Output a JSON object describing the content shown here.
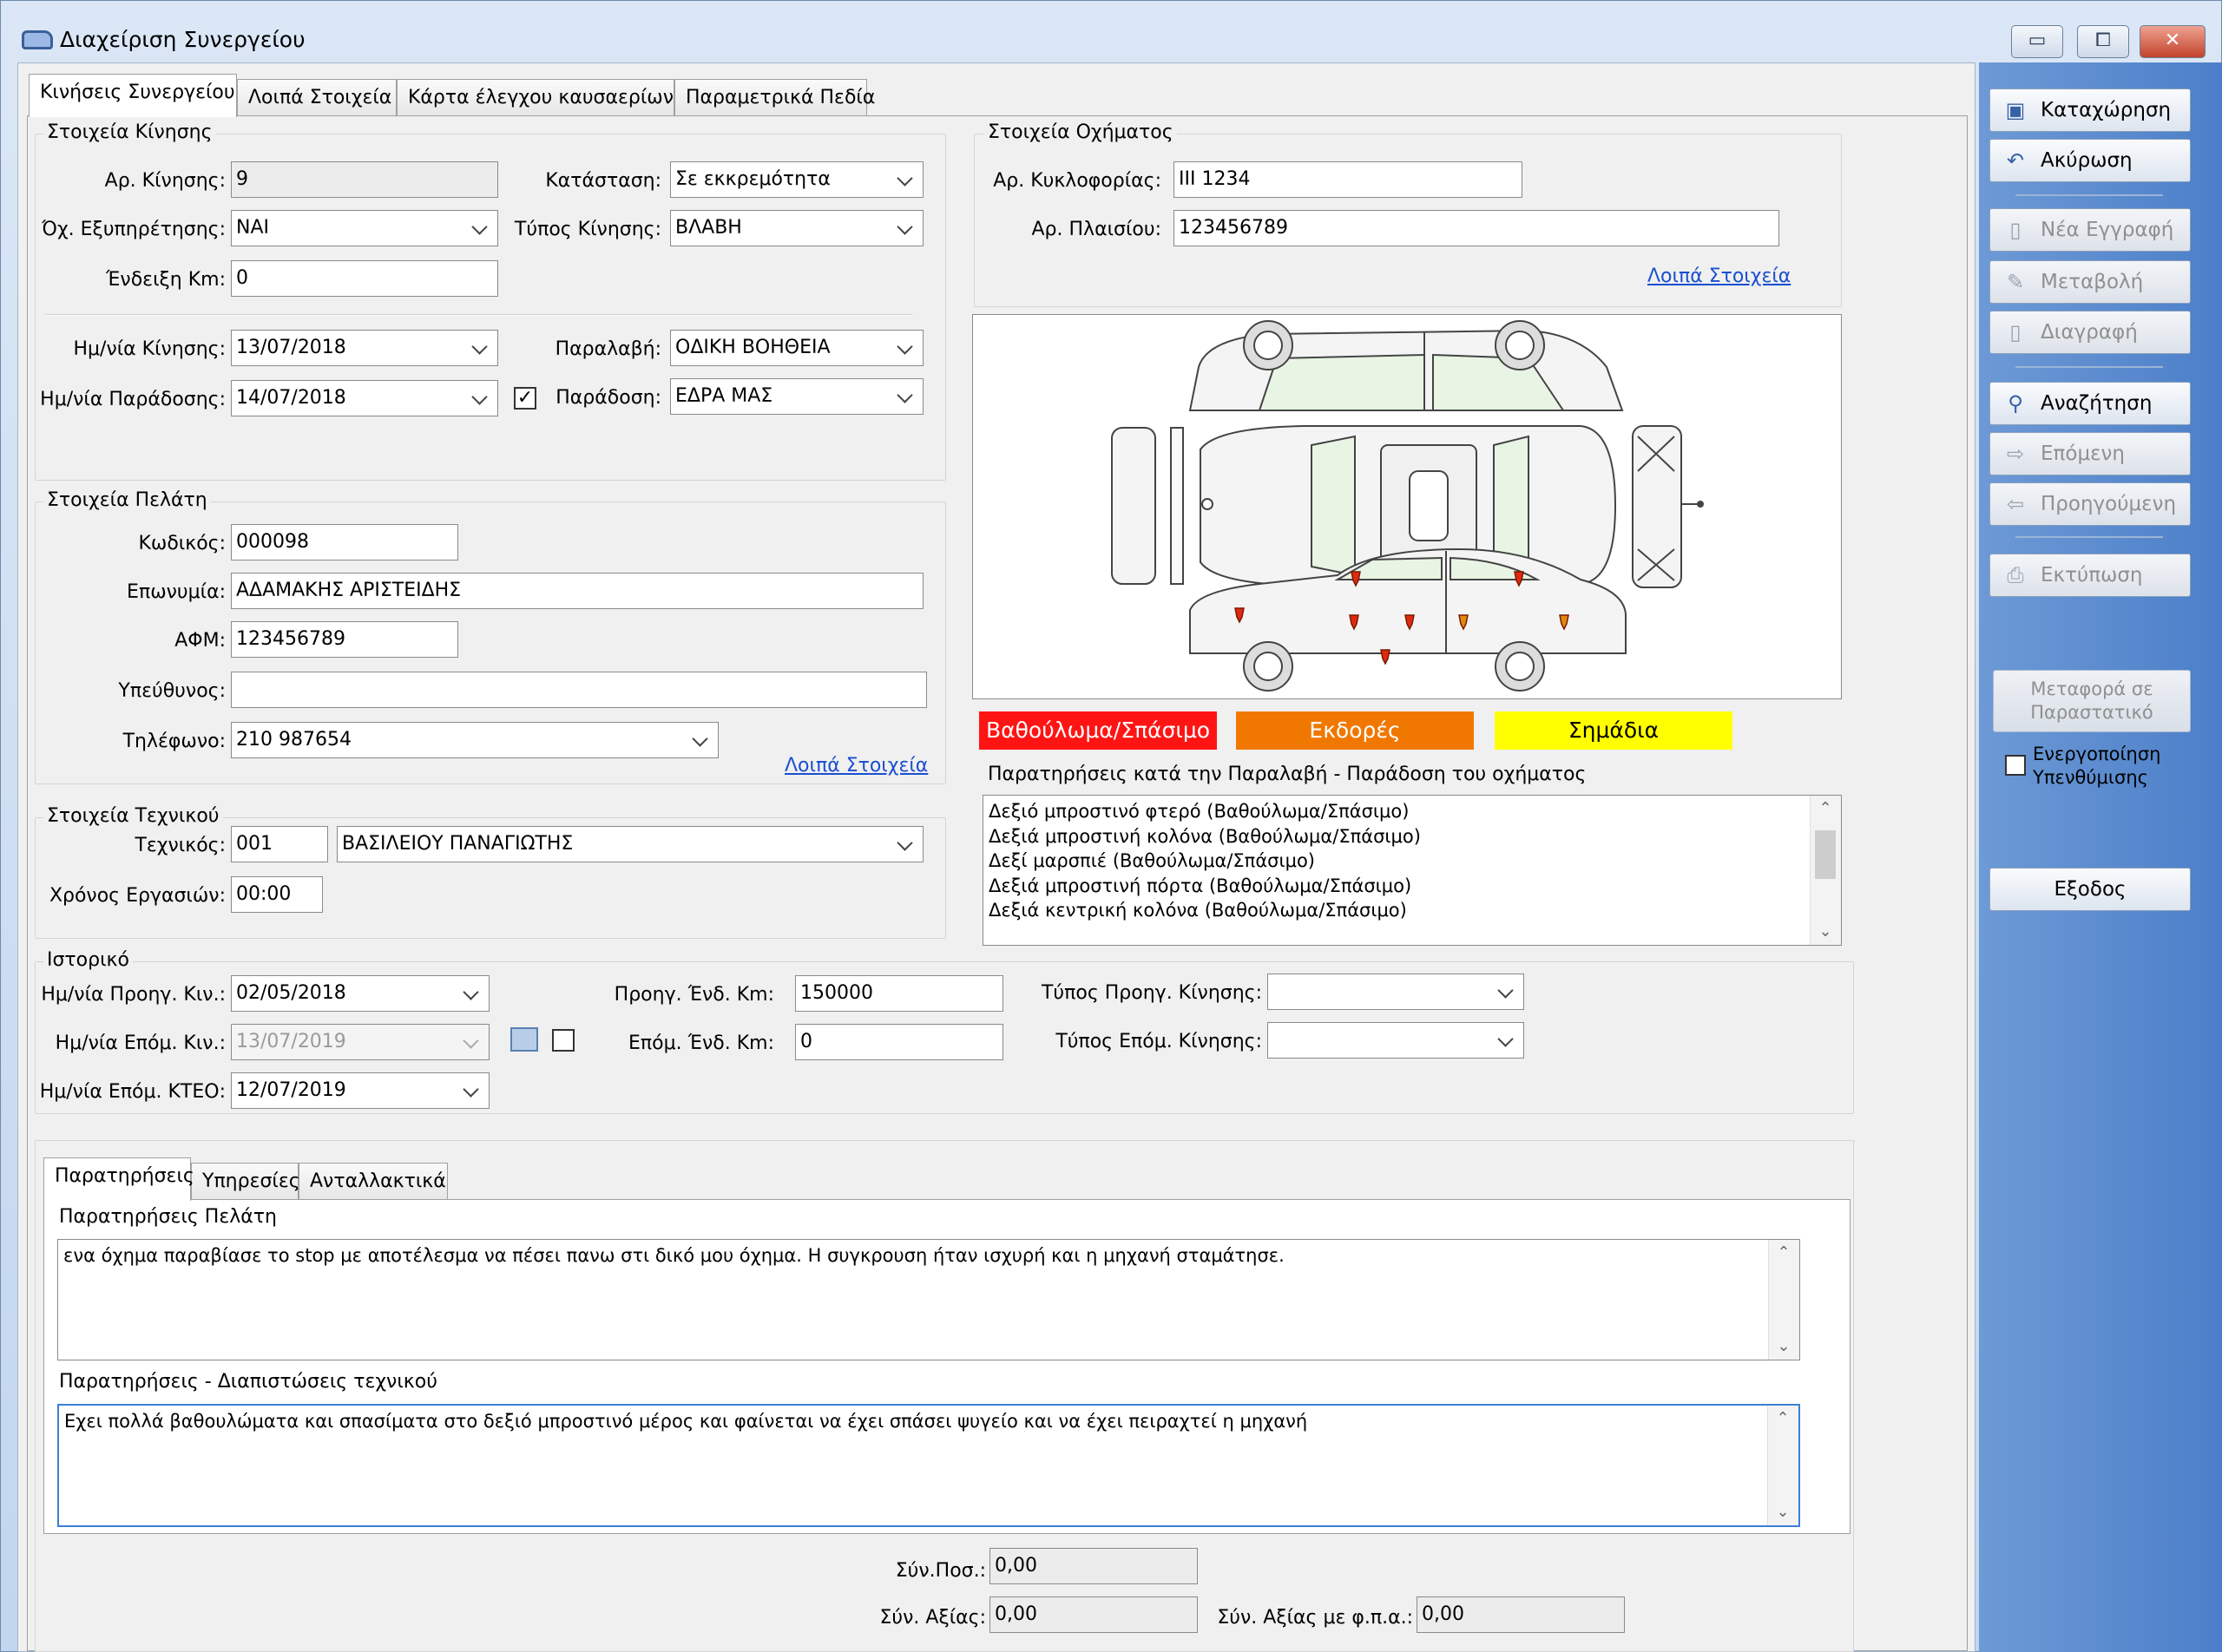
{
  "window": {
    "title": "Διαχείριση Συνεργείου",
    "minimize": "▭",
    "maximize": "⧠",
    "close": "✕"
  },
  "tabs": [
    "Κινήσεις Συνεργείου",
    "Λοιπά Στοιχεία",
    "Κάρτα έλεγχου καυσαερίων",
    "Παραμετρικά Πεδία"
  ],
  "movement": {
    "group_title": "Στοιχεία Κίνησης",
    "number_label": "Αρ. Κίνησης:",
    "number": "9",
    "status_label": "Κατάσταση:",
    "status": "Σε εκκρεμότητα",
    "service_vehicle_label": "Όχ. Εξυπηρέτησης:",
    "service_vehicle": "ΝΑΙ",
    "type_label": "Τύπος Κίνησης:",
    "type": "ΒΛΑΒΗ",
    "km_label": "Ένδειξη Km:",
    "km": "0",
    "date_label": "Ημ/νία Κίνησης:",
    "date": "13/07/2018",
    "pickup_label": "Παραλαβή:",
    "pickup": "ΟΔΙΚΗ ΒΟΗΘΕΙΑ",
    "delivery_date_label": "Ημ/νία Παράδοσης:",
    "delivery_date": "14/07/2018",
    "delivery_label": "Παράδοση:",
    "delivery": "ΕΔΡΑ ΜΑΣ",
    "delivery_checked": "✓"
  },
  "vehicle": {
    "group_title": "Στοιχεία Οχήματος",
    "plate_label": "Αρ. Κυκλοφορίας:",
    "plate": "ΙΙΙ 1234",
    "chassis_label": "Αρ. Πλαισίου:",
    "chassis": "123456789",
    "more_link": "Λοιπά Στοιχεία"
  },
  "damage_legend": [
    {
      "label": "Βαθούλωμα/Σπάσιμο",
      "color": "#ff1414"
    },
    {
      "label": "Εκδορές",
      "color": "#f07800"
    },
    {
      "label": "Σημάδια",
      "color": "#ffff00"
    }
  ],
  "remarks_pickup": {
    "label": "Παρατηρήσεις κατά την Παραλαβή - Παράδοση του οχήματος",
    "lines": [
      "Δεξιό μπροστινό φτερό (Βαθούλωμα/Σπάσιμο)",
      "Δεξιά μπροστινή κολόνα (Βαθούλωμα/Σπάσιμο)",
      "Δεξί μαρσπιέ (Βαθούλωμα/Σπάσιμο)",
      "Δεξιά μπροστινή πόρτα (Βαθούλωμα/Σπάσιμο)",
      "Δεξιά κεντρική κολόνα (Βαθούλωμα/Σπάσιμο)"
    ]
  },
  "customer": {
    "group_title": "Στοιχεία Πελάτη",
    "code_label": "Κωδικός:",
    "code": "000098",
    "name_label": "Επωνυμία:",
    "name": "ΑΔΑΜΑΚΗΣ ΑΡΙΣΤΕΙΔΗΣ",
    "afm_label": "ΑΦΜ:",
    "afm": "123456789",
    "responsible_label": "Υπεύθυνος:",
    "responsible": "",
    "phone_label": "Τηλέφωνο:",
    "phone": "210 987654",
    "more_link": "Λοιπά Στοιχεία"
  },
  "technician": {
    "group_title": "Στοιχεία Τεχνικού",
    "tech_label": "Τεχνικός:",
    "tech_code": "001",
    "tech_name": "ΒΑΣΙΛΕΙΟΥ ΠΑΝΑΓΙΩΤΗΣ",
    "time_label": "Χρόνος Εργασιών:",
    "time": "00:00"
  },
  "history": {
    "group_title": "Ιστορικό",
    "prev_date_label": "Ημ/νία Προηγ. Κιν.:",
    "prev_date": "02/05/2018",
    "prev_km_label": "Προηγ. Ένδ. Km:",
    "prev_km": "150000",
    "prev_type_label": "Τύπος Προηγ. Κίνησης:",
    "prev_type": "",
    "next_date_label": "Ημ/νία Επόμ. Κιν.:",
    "next_date": "13/07/2019",
    "next_km_label": "Επόμ. Ένδ. Km:",
    "next_km": "0",
    "next_type_label": "Τύπος Επόμ. Κίνησης:",
    "next_type": "",
    "ktev_label": "Ημ/νία Επόμ. ΚΤΕΟ:",
    "ktev": "12/07/2019"
  },
  "subtabs": [
    "Παρατηρήσεις",
    "Υπηρεσίες",
    "Ανταλλακτικά"
  ],
  "notes": {
    "customer_label": "Παρατηρήσεις Πελάτη",
    "customer_text": "ενα όχημα παραβίασε το stop με αποτέλεσμα να πέσει πανω στι δικό μου όχημα. Η συγκρουση ήταν ισχυρή και η μηχανή σταμάτησε.",
    "tech_label": "Παρατηρήσεις - Διαπιστώσεις τεχνικού",
    "tech_text": "Εχει πολλά βαθουλώματα και σπασίματα στο δεξιό μπροστινό μέρος και φαίνεται να έχει σπάσει ψυγείο και να έχει πειραχτεί η μηχανή"
  },
  "totals": {
    "qty_label": "Σύν.Ποσ.:",
    "qty": "0,00",
    "value_label": "Σύν. Αξίας:",
    "value": "0,00",
    "value_vat_label": "Σύν. Αξίας με φ.π.α.:",
    "value_vat": "0,00"
  },
  "sidebar": {
    "save": "Καταχώρηση",
    "cancel": "Ακύρωση",
    "new": "Νέα Εγγραφή",
    "edit": "Μεταβολή",
    "delete": "Διαγραφή",
    "search": "Αναζήτηση",
    "next": "Επόμενη",
    "previous": "Προηγούμενη",
    "print": "Εκτύπωση",
    "transfer": "Μεταφορά σε Παραστατικό",
    "reminder": "Ενεργοποίηση Υπενθύμισης",
    "exit": "Εξοδος"
  }
}
